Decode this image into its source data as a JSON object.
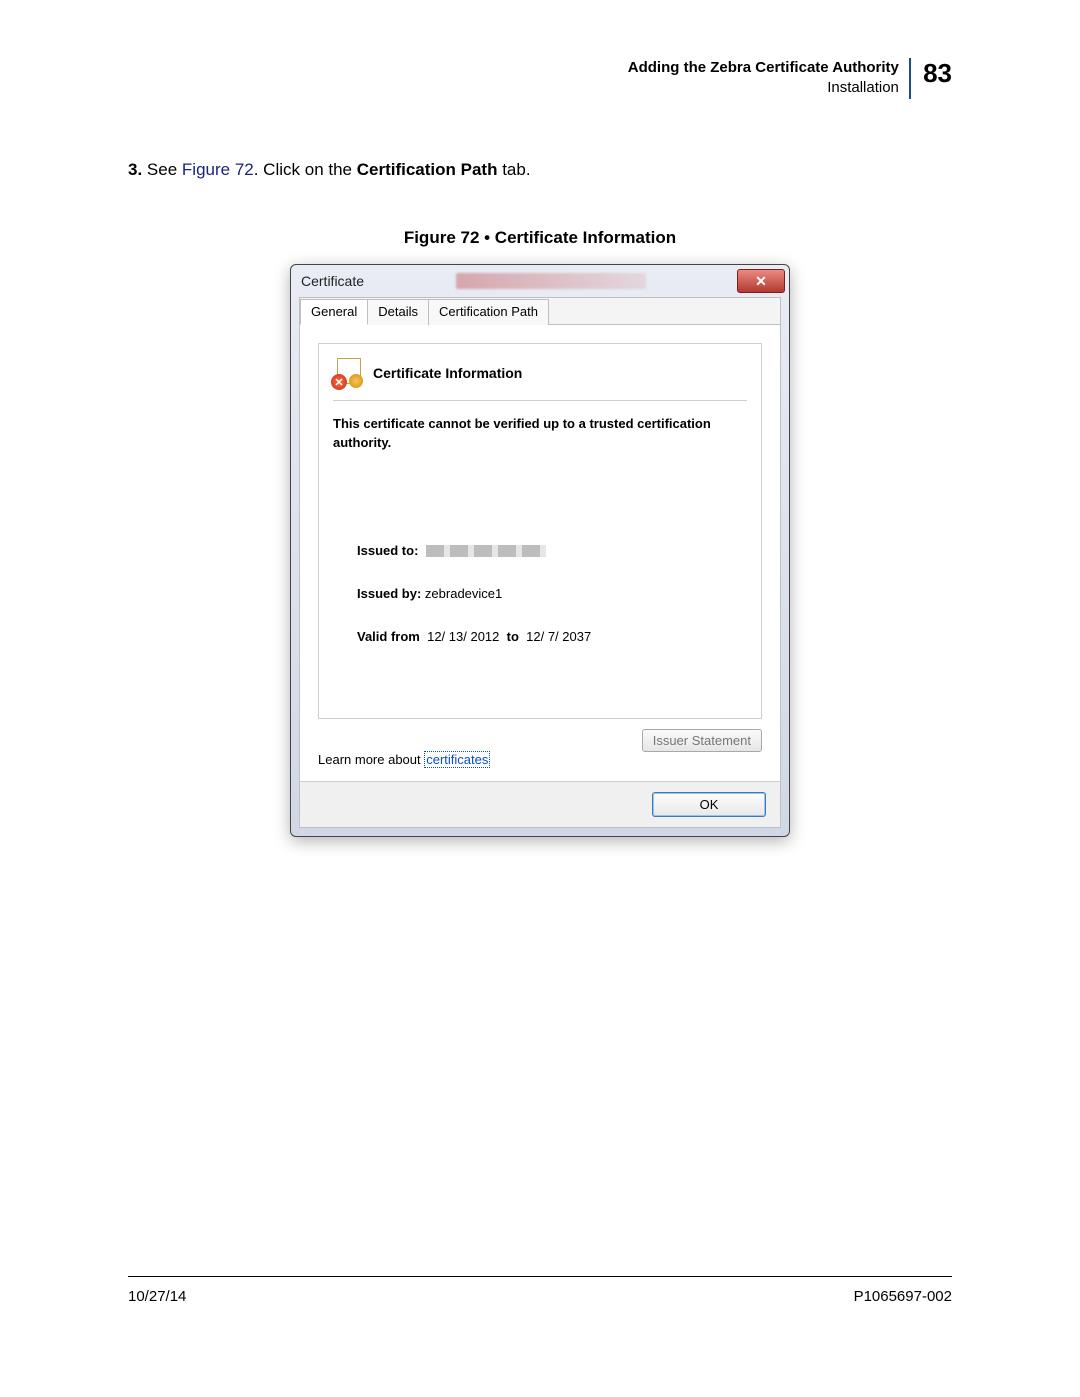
{
  "header": {
    "title": "Adding the Zebra Certificate Authority",
    "subtitle": "Installation",
    "page_number": "83"
  },
  "step": {
    "number": "3.",
    "prefix": "See ",
    "figref": "Figure 72",
    "middle": ". Click on the ",
    "bold_part": "Certification Path",
    "suffix": " tab."
  },
  "figure_caption": "Figure 72 • Certificate Information",
  "dialog": {
    "title": "Certificate",
    "close_label": "✕",
    "tabs": {
      "general": "General",
      "details": "Details",
      "cert_path": "Certification Path"
    },
    "cert_section_title": "Certificate Information",
    "cert_message": "This certificate cannot be verified up to a trusted certification authority.",
    "issued_to_label": "Issued to:",
    "issued_by_label": "Issued by:",
    "issued_by_value": "zebradevice1",
    "valid_from_label": "Valid from",
    "valid_from_value": "12/ 13/ 2012",
    "valid_to_label": "to",
    "valid_to_value": "12/ 7/ 2037",
    "issuer_statement_btn": "Issuer Statement",
    "learn_prefix": "Learn more about ",
    "learn_link": "certificates",
    "ok_label": "OK"
  },
  "footer": {
    "date": "10/27/14",
    "docnum": "P1065697-002"
  }
}
